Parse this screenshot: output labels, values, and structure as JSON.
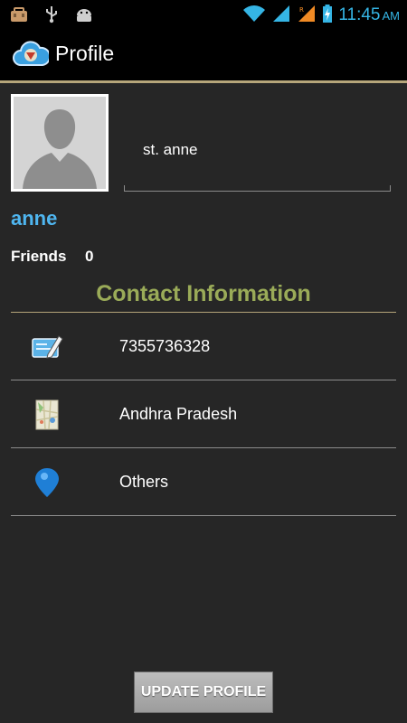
{
  "status_bar": {
    "time": "11:45",
    "ampm": "AM",
    "icons": [
      "bag-icon",
      "usb-icon",
      "android-icon",
      "wifi-icon",
      "signal-icon",
      "roaming-signal-icon",
      "battery-charging-icon"
    ],
    "accent_color": "#35b5e5"
  },
  "action_bar": {
    "title": "Profile"
  },
  "profile": {
    "school": "st. anne",
    "username": "anne",
    "friends_label": "Friends",
    "friends_count": "0"
  },
  "contact": {
    "heading": "Contact Information",
    "items": [
      {
        "icon": "edit-card-icon",
        "label": "7355736328"
      },
      {
        "icon": "map-icon",
        "label": "Andhra Pradesh"
      },
      {
        "icon": "location-pin-icon",
        "label": "Others"
      }
    ]
  },
  "buttons": {
    "update_label": "UPDATE PROFILE"
  }
}
